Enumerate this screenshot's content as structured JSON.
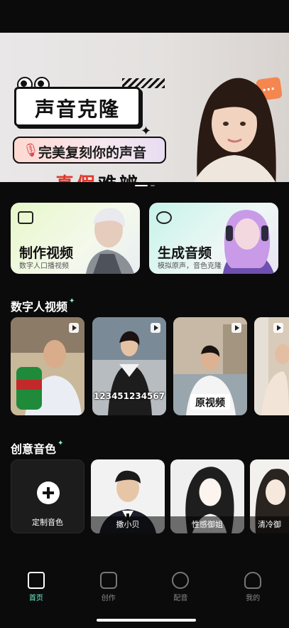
{
  "banner": {
    "title": "声音克隆",
    "subtitle": "完美复刻你的声音",
    "tag_prefix": "真假",
    "tag_suffix": "难辨"
  },
  "features": [
    {
      "title": "制作视频",
      "subtitle": "数字人口播视频"
    },
    {
      "title": "生成音频",
      "subtitle": "模拟原声，音色克隆"
    }
  ],
  "digital_human_section": {
    "title": "数字人视频",
    "videos": [
      {
        "caption": ""
      },
      {
        "caption": "123451234567"
      },
      {
        "caption": "原视频"
      },
      {
        "caption": ""
      }
    ]
  },
  "voice_section": {
    "title": "创意音色",
    "tiles": [
      {
        "label": "定制音色"
      },
      {
        "label": "撒小贝"
      },
      {
        "label": "性感御姐"
      },
      {
        "label": "清冷御"
      }
    ]
  },
  "nav": {
    "items": [
      {
        "label": "首页",
        "icon": "clapboard-icon",
        "active": true
      },
      {
        "label": "创作",
        "icon": "smile-box-icon",
        "active": false
      },
      {
        "label": "配音",
        "icon": "chat-bubble-icon",
        "active": false
      },
      {
        "label": "我的",
        "icon": "user-icon",
        "active": false
      }
    ]
  },
  "colors": {
    "accent": "#6ff0d0",
    "background": "#0b0b0b",
    "banner_red": "#e0382b"
  }
}
